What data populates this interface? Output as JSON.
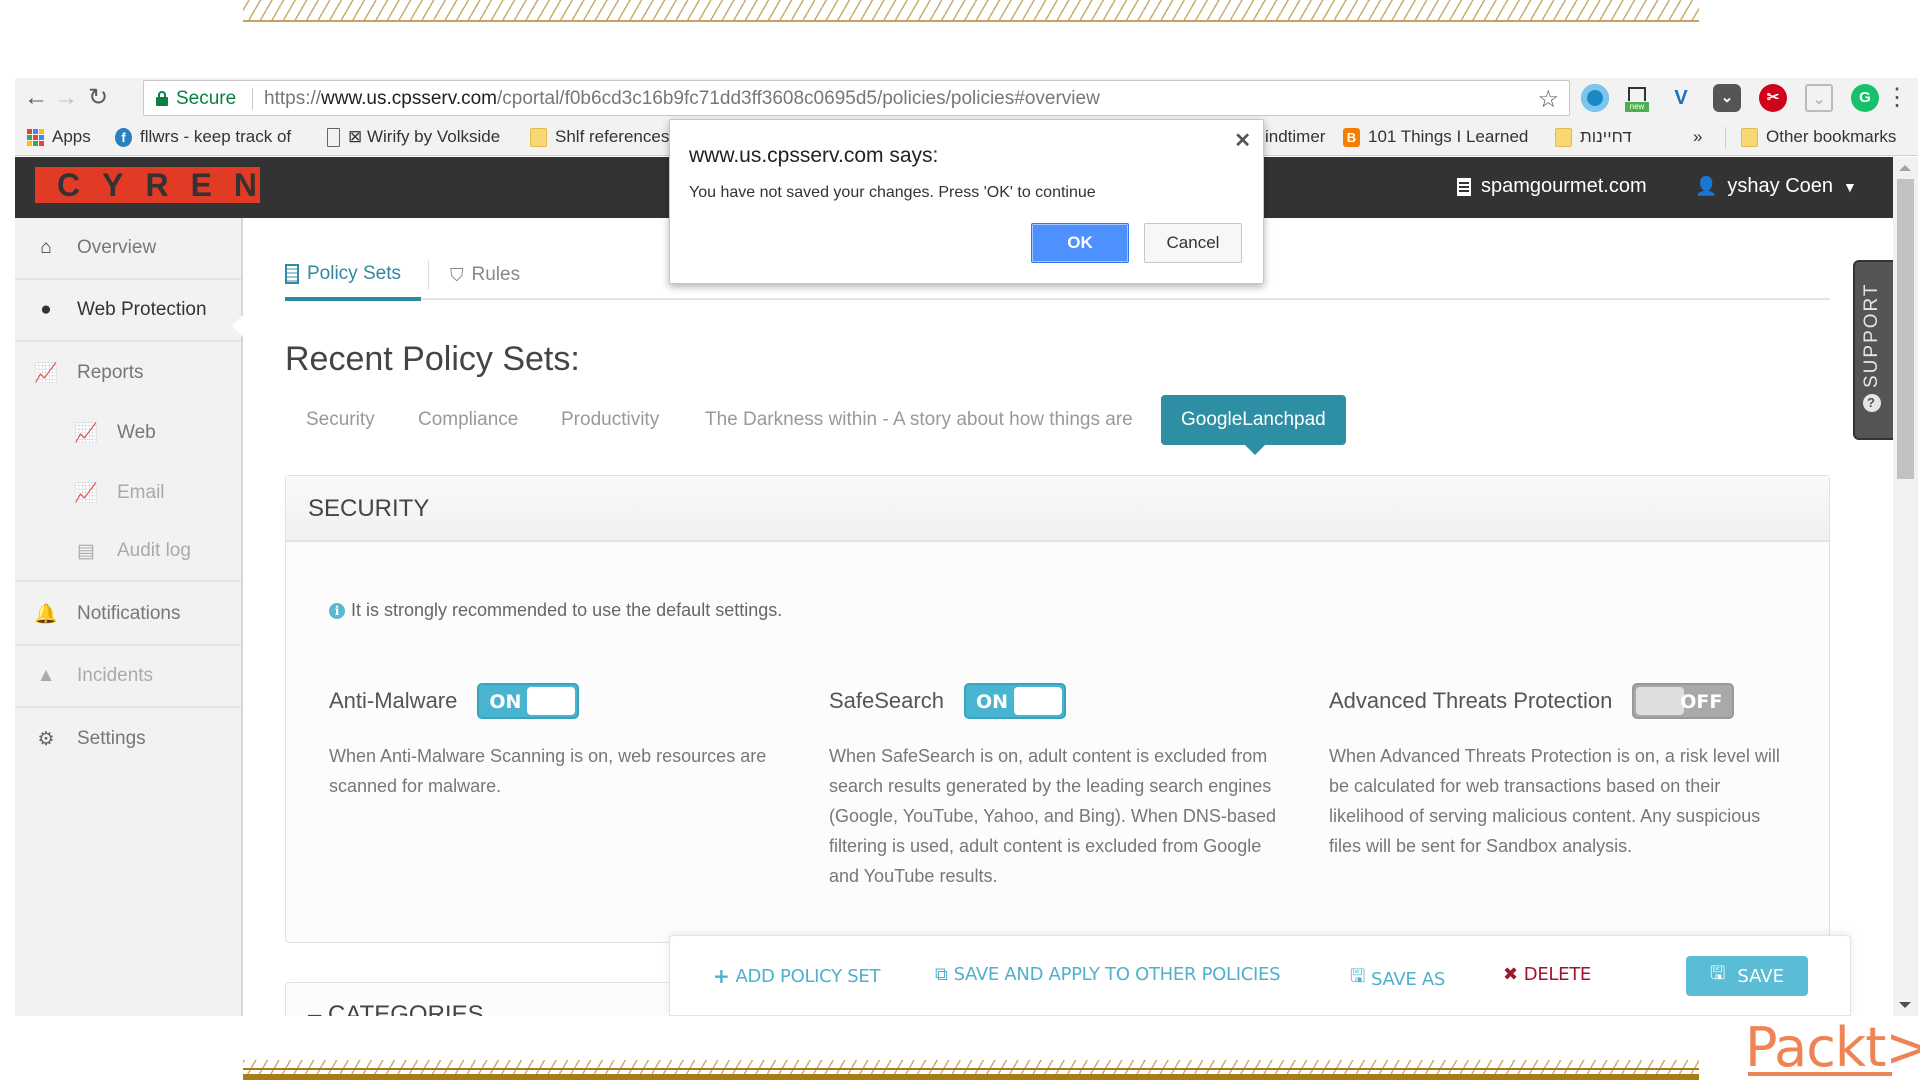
{
  "browser": {
    "secure_label": "Secure",
    "url_scheme": "https://",
    "url_host": "www.us.cpsserv.com",
    "url_path": "/cportal/f0b6cd3c16b9fc71dd3ff3608c0695d5/policies/policies#overview",
    "ext_new_badge": "new",
    "bookmarks": [
      {
        "label": "Apps",
        "icon": "apps-grid-icon"
      },
      {
        "label": "fllwrs - keep track of",
        "icon": "fllwrs-icon"
      },
      {
        "label": "⊠ Wirify by Volkside",
        "icon": "page-icon"
      },
      {
        "label": "Shlf references",
        "icon": "folder-icon"
      },
      {
        "label": "indtimer",
        "icon": "none"
      },
      {
        "label": "101 Things I Learned",
        "icon": "blogger-icon"
      },
      {
        "label": "דחיינות",
        "icon": "folder-icon"
      }
    ],
    "overflow": "»",
    "other_bookmarks": "Other bookmarks"
  },
  "header": {
    "logo": "CYREN",
    "account": "spamgourmet.com",
    "user": "yshay Coen"
  },
  "sidebar": {
    "items": [
      {
        "label": "Overview",
        "icon": "home-icon"
      },
      {
        "label": "Web Protection",
        "icon": "globe-icon",
        "active": true
      },
      {
        "label": "Reports",
        "icon": "chart-icon"
      },
      {
        "label": "Web",
        "icon": "chart-globe-icon"
      },
      {
        "label": "Email",
        "icon": "chart-mail-icon"
      },
      {
        "label": "Audit log",
        "icon": "list-icon"
      },
      {
        "label": "Notifications",
        "icon": "bell-icon"
      },
      {
        "label": "Incidents",
        "icon": "warning-icon"
      },
      {
        "label": "Settings",
        "icon": "gear-icon"
      }
    ]
  },
  "tabs": [
    {
      "label": "Policy Sets",
      "active": true
    },
    {
      "label": "Rules",
      "active": false
    }
  ],
  "page_title": "Recent Policy Sets:",
  "policy_sets": [
    "Security",
    "Compliance",
    "Productivity",
    "The Darkness within - A story about how things are",
    "GoogleLanchpad"
  ],
  "active_policy_set": "GoogleLanchpad",
  "security_panel": {
    "title": "SECURITY",
    "hint": "It is strongly recommended to use the default settings.",
    "features": [
      {
        "name": "Anti-Malware",
        "state": "ON",
        "enabled": true,
        "description": "When Anti-Malware Scanning is on, web resources are scanned for malware."
      },
      {
        "name": "SafeSearch",
        "state": "ON",
        "enabled": true,
        "description": "When SafeSearch is on, adult content is excluded from search results generated by the leading search engines (Google, YouTube, Yahoo, and Bing). When DNS-based filtering is used, adult content is excluded from Google and YouTube results."
      },
      {
        "name": "Advanced Threats Protection",
        "state": "OFF",
        "enabled": false,
        "description": "When Advanced Threats Protection is on, a risk level will be calculated for web transactions based on their likelihood of serving malicious content. Any suspicious files will be sent for Sandbox analysis."
      }
    ]
  },
  "categories_panel": {
    "title": "– CATEGORIES"
  },
  "actions": {
    "add": "ADD POLICY SET",
    "save_apply": "SAVE AND APPLY TO OTHER POLICIES",
    "save_as": "SAVE AS",
    "delete": "DELETE",
    "save": "SAVE"
  },
  "support_label": "SUPPORT",
  "dialog": {
    "title": "www.us.cpsserv.com says:",
    "message": "You have not saved your changes. Press 'OK' to continue",
    "ok": "OK",
    "cancel": "Cancel"
  },
  "watermark": "Packt>",
  "colors": {
    "accent": "#2d8ea4",
    "logo_red": "#e13a25",
    "toggle_on": "#48b4cf",
    "delete_red": "#a1142e",
    "packt_orange": "#ef8354"
  }
}
